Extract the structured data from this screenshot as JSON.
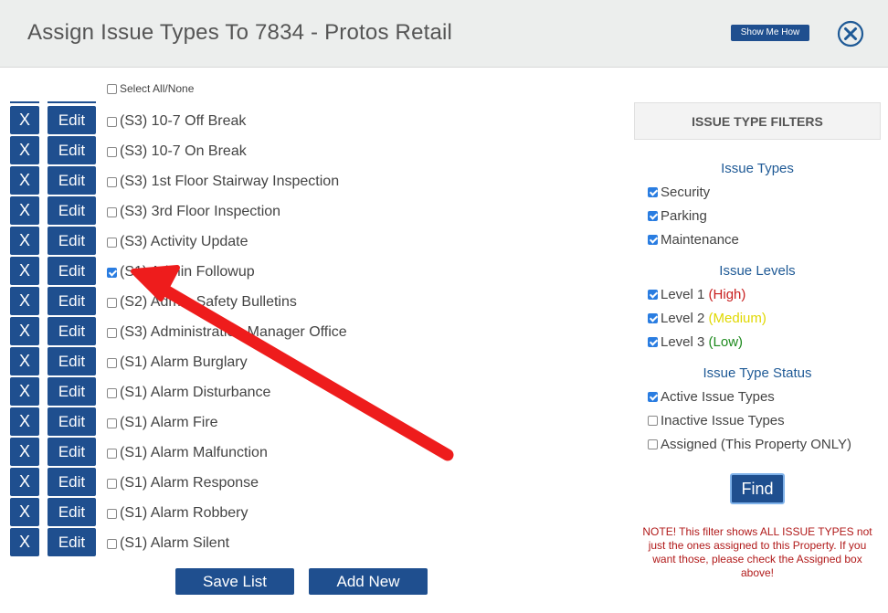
{
  "header": {
    "title": "Assign Issue Types To 7834 - Protos Retail",
    "show_me_how": "Show Me How",
    "close_icon": "close-circle-icon"
  },
  "select_all": {
    "label": "Select All/None",
    "checked": false
  },
  "list": {
    "x_label": "X",
    "edit_label": "Edit",
    "items": [
      {
        "label": "(S3) 10-7 Off Break",
        "checked": false
      },
      {
        "label": "(S3) 10-7 On Break",
        "checked": false
      },
      {
        "label": "(S3) 1st Floor Stairway Inspection",
        "checked": false
      },
      {
        "label": "(S3) 3rd Floor Inspection",
        "checked": false
      },
      {
        "label": "(S3) Activity Update",
        "checked": false
      },
      {
        "label": "(S1) Admin Followup",
        "checked": true
      },
      {
        "label": "(S2) Admin Safety Bulletins",
        "checked": false
      },
      {
        "label": "(S3) Administration Manager Office",
        "checked": false
      },
      {
        "label": "(S1) Alarm Burglary",
        "checked": false
      },
      {
        "label": "(S1) Alarm Disturbance",
        "checked": false
      },
      {
        "label": "(S1) Alarm Fire",
        "checked": false
      },
      {
        "label": "(S1) Alarm Malfunction",
        "checked": false
      },
      {
        "label": "(S1) Alarm Response",
        "checked": false
      },
      {
        "label": "(S1) Alarm Robbery",
        "checked": false
      },
      {
        "label": "(S1) Alarm Silent",
        "checked": false
      }
    ]
  },
  "actions": {
    "save_list": "Save List",
    "add_new": "Add New"
  },
  "filters": {
    "title": "ISSUE TYPE FILTERS",
    "issue_types": {
      "title": "Issue Types",
      "items": [
        {
          "label": "Security",
          "checked": true
        },
        {
          "label": "Parking",
          "checked": true
        },
        {
          "label": "Maintenance",
          "checked": true
        }
      ]
    },
    "issue_levels": {
      "title": "Issue Levels",
      "items": [
        {
          "label": "Level 1",
          "qualifier": "(High)",
          "checked": true
        },
        {
          "label": "Level 2",
          "qualifier": "(Medium)",
          "checked": true
        },
        {
          "label": "Level 3",
          "qualifier": "(Low)",
          "checked": true
        }
      ]
    },
    "status": {
      "title": "Issue Type Status",
      "items": [
        {
          "label": "Active Issue Types",
          "checked": true
        },
        {
          "label": "Inactive Issue Types",
          "checked": false
        },
        {
          "label": "Assigned (This Property ONLY)",
          "checked": false
        }
      ]
    },
    "find": "Find",
    "note": "NOTE! This filter shows ALL ISSUE TYPES not just the ones assigned to this Property. If you want those, please check the Assigned box above!"
  },
  "colors": {
    "primary": "#1f4f8f",
    "checkbox": "#2a7de1",
    "annotation_arrow": "#ee1c1c",
    "high": "#c81e1e",
    "medium": "#e0d800",
    "low": "#1e8a1e"
  }
}
